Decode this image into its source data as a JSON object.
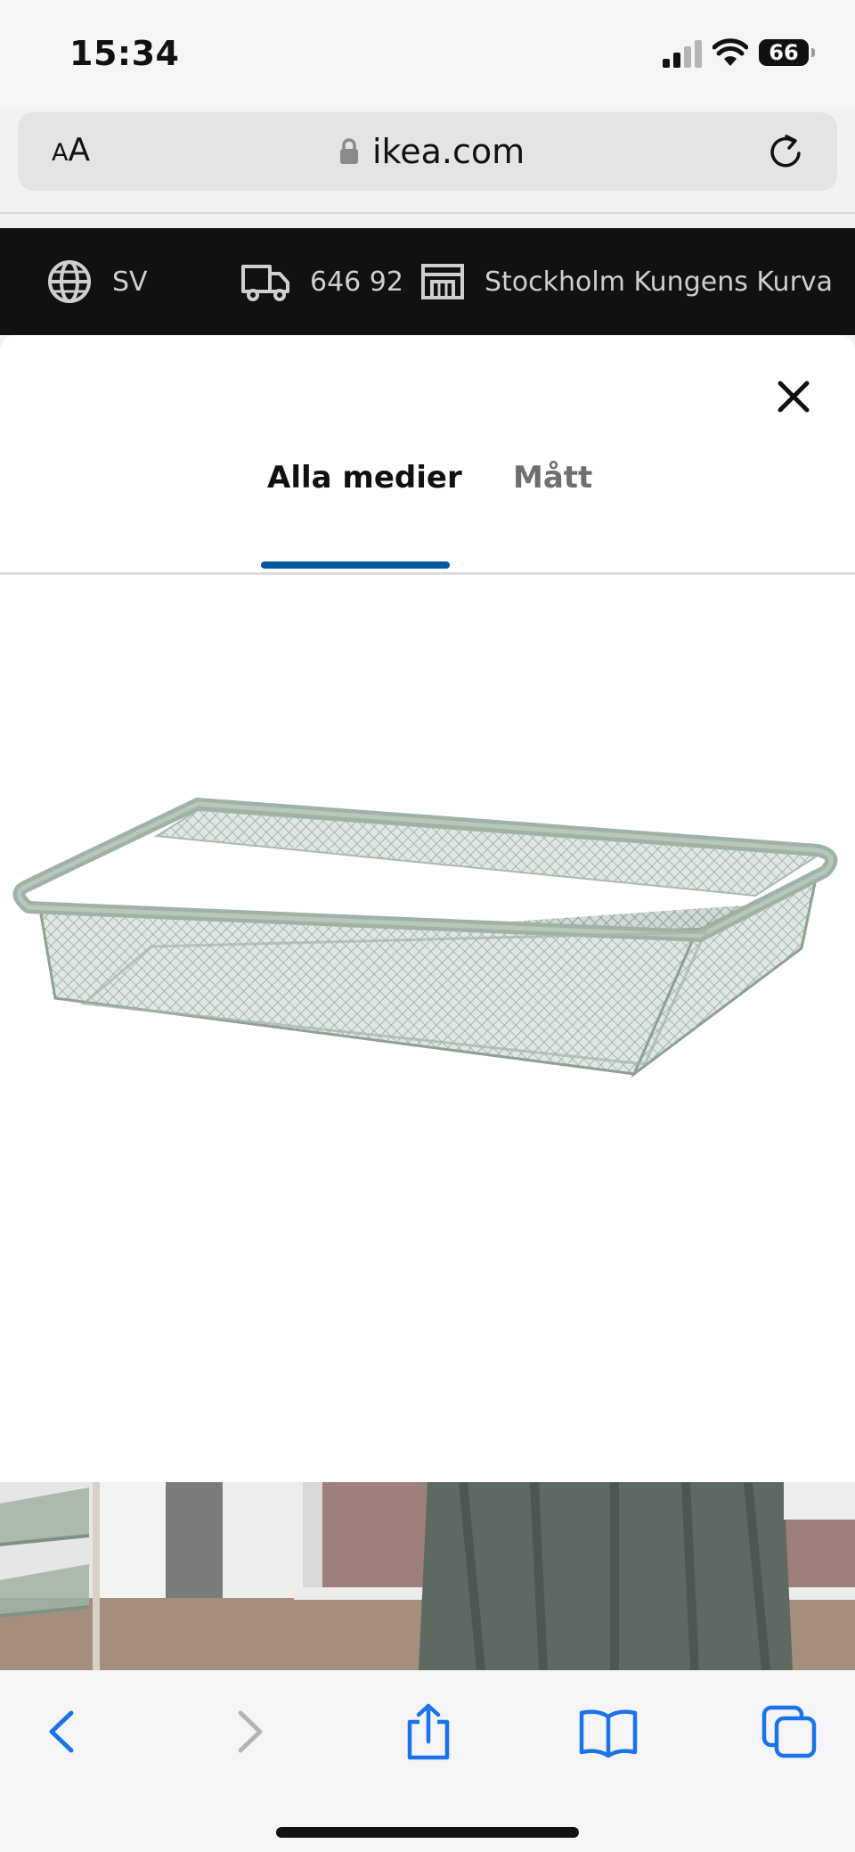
{
  "status_bar": {
    "time": "15:34",
    "battery": "66",
    "icons": [
      "cellular-signal-icon",
      "wifi-icon",
      "battery-icon"
    ]
  },
  "browser": {
    "text_size_label": {
      "small": "A",
      "large": "A"
    },
    "url": "ikea.com",
    "icons": [
      "lock-icon",
      "reload-icon"
    ]
  },
  "site_header": {
    "language": "SV",
    "postal_code": "646 92",
    "store": "Stockholm Kungens Kurva",
    "icons": [
      "globe-icon",
      "delivery-truck-icon",
      "store-icon"
    ]
  },
  "media_modal": {
    "tabs": [
      {
        "label": "Alla medier",
        "active": true
      },
      {
        "label": "Mått",
        "active": false
      }
    ],
    "close_icon": "close-icon",
    "accent_color": "#0058a3",
    "product_color": "#9fb3a5"
  },
  "toolbar": {
    "buttons": [
      "back-icon",
      "forward-icon",
      "share-icon",
      "bookmarks-icon",
      "tabs-icon"
    ],
    "accent_color": "#1a73e8"
  }
}
